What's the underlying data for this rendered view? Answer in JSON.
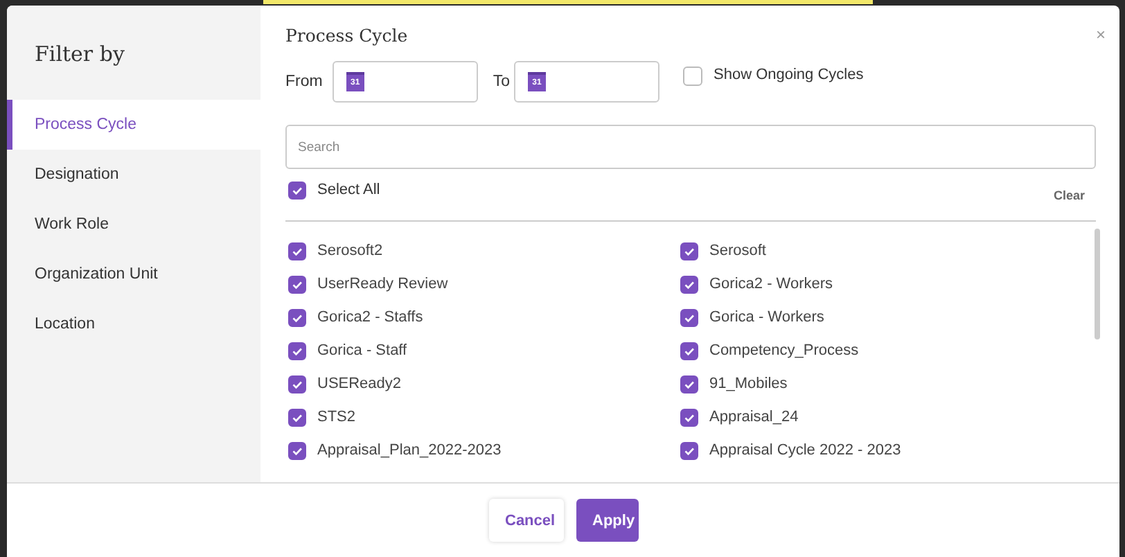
{
  "sidebar": {
    "title": "Filter by",
    "items": [
      {
        "label": "Process Cycle",
        "selected": true
      },
      {
        "label": "Designation",
        "selected": false
      },
      {
        "label": "Work Role",
        "selected": false
      },
      {
        "label": "Organization Unit",
        "selected": false
      },
      {
        "label": "Location",
        "selected": false
      }
    ]
  },
  "panel": {
    "title": "Process Cycle",
    "close": "×",
    "from_label": "From",
    "to_label": "To",
    "from_calendar_day": "31",
    "to_calendar_day": "31",
    "ongoing": {
      "label": "Show Ongoing Cycles",
      "checked": false
    },
    "search": {
      "placeholder": "Search"
    },
    "select_all": {
      "label": "Select All",
      "checked": true
    },
    "clear": "Clear",
    "options": [
      {
        "label": "Serosoft2",
        "checked": true
      },
      {
        "label": "Serosoft",
        "checked": true
      },
      {
        "label": "UserReady Review",
        "checked": true
      },
      {
        "label": "Gorica2 - Workers",
        "checked": true
      },
      {
        "label": "Gorica2 - Staffs",
        "checked": true
      },
      {
        "label": "Gorica - Workers",
        "checked": true
      },
      {
        "label": "Gorica - Staff",
        "checked": true
      },
      {
        "label": "Competency_Process",
        "checked": true
      },
      {
        "label": "USEReady2",
        "checked": true
      },
      {
        "label": "91_Mobiles",
        "checked": true
      },
      {
        "label": "STS2",
        "checked": true
      },
      {
        "label": "Appraisal_24",
        "checked": true
      },
      {
        "label": "Appraisal_Plan_2022-2023",
        "checked": true
      },
      {
        "label": "Appraisal Cycle 2022 - 2023",
        "checked": true
      }
    ]
  },
  "footer": {
    "buttons": [
      {
        "label": "Cancel",
        "kind": "secondary"
      },
      {
        "label": "Apply",
        "kind": "primary"
      }
    ]
  }
}
